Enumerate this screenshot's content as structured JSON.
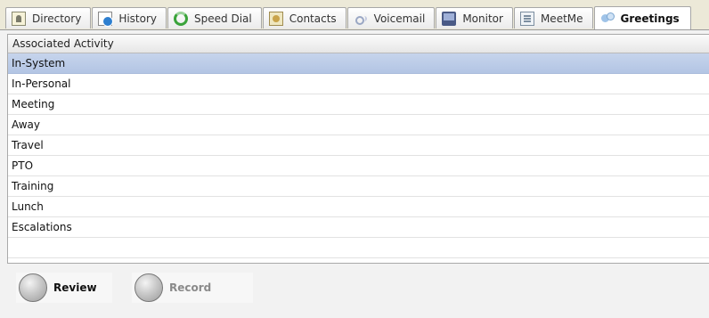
{
  "tabs": [
    {
      "label": "Directory",
      "icon": "directory-icon"
    },
    {
      "label": "History",
      "icon": "history-icon"
    },
    {
      "label": "Speed Dial",
      "icon": "speed-dial-icon"
    },
    {
      "label": "Contacts",
      "icon": "contacts-icon"
    },
    {
      "label": "Voicemail",
      "icon": "voicemail-icon"
    },
    {
      "label": "Monitor",
      "icon": "monitor-icon"
    },
    {
      "label": "MeetMe",
      "icon": "meetme-icon"
    },
    {
      "label": "Greetings",
      "icon": "greetings-icon",
      "active": true
    }
  ],
  "table": {
    "column_header": "Associated Activity",
    "selected_index": 0,
    "rows": [
      "In-System",
      "In-Personal",
      "Meeting",
      "Away",
      "Travel",
      "PTO",
      "Training",
      "Lunch",
      "Escalations"
    ]
  },
  "controls": {
    "review_label": "Review",
    "record_label": "Record"
  },
  "colors": {
    "selected_row": "#c6d4ec",
    "disabled_text": "#8a8a8a"
  }
}
